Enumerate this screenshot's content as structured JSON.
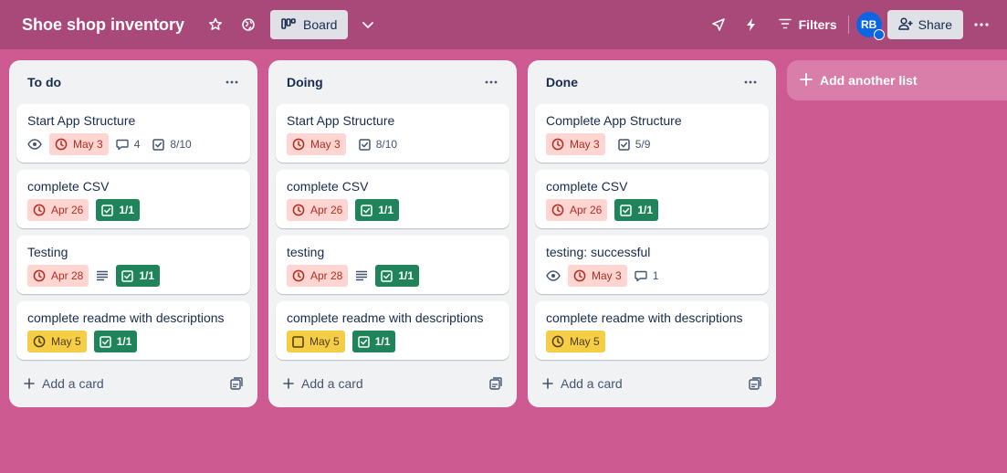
{
  "header": {
    "title": "Shoe shop inventory",
    "view_label": "Board",
    "filters_label": "Filters",
    "avatar_initials": "RB",
    "share_label": "Share"
  },
  "lists": [
    {
      "title": "To do",
      "cards": [
        {
          "title": "Start App Structure",
          "watch": true,
          "due": "May 3",
          "due_style": "red",
          "comments": "4",
          "checklist": "8/10",
          "check_done": false
        },
        {
          "title": "complete CSV",
          "due": "Apr 26",
          "due_style": "red",
          "checklist": "1/1",
          "check_done": true
        },
        {
          "title": "Testing",
          "due": "Apr 28",
          "due_style": "red",
          "description": true,
          "checklist": "1/1",
          "check_done": true
        },
        {
          "title": "complete readme with descriptions",
          "due": "May 5",
          "due_style": "yellow",
          "checklist": "1/1",
          "check_done": true
        }
      ],
      "add_card_label": "Add a card"
    },
    {
      "title": "Doing",
      "cards": [
        {
          "title": "Start App Structure",
          "due": "May 3",
          "due_style": "red",
          "checklist": "8/10",
          "check_done": false
        },
        {
          "title": "complete CSV",
          "due": "Apr 26",
          "due_style": "red",
          "checklist": "1/1",
          "check_done": true
        },
        {
          "title": "testing",
          "due": "Apr 28",
          "due_style": "red",
          "description": true,
          "checklist": "1/1",
          "check_done": true
        },
        {
          "title": "complete readme with descriptions",
          "due": "May 5",
          "due_style": "yellow",
          "due_checkbox": true,
          "checklist": "1/1",
          "check_done": true
        }
      ],
      "add_card_label": "Add a card"
    },
    {
      "title": "Done",
      "cards": [
        {
          "title": "Complete App Structure",
          "due": "May 3",
          "due_style": "red",
          "checklist": "5/9",
          "check_done": false
        },
        {
          "title": "complete CSV",
          "due": "Apr 26",
          "due_style": "red",
          "checklist": "1/1",
          "check_done": true
        },
        {
          "title": "testing: successful",
          "watch": true,
          "due": "May 3",
          "due_style": "red",
          "comments": "1"
        },
        {
          "title": "complete readme with descriptions",
          "due": "May 5",
          "due_style": "yellow"
        }
      ],
      "add_card_label": "Add a card"
    }
  ],
  "add_list_label": "Add another list",
  "colors": {
    "board_background": "#cd5a91",
    "header_background": "#a8497a",
    "due_red_bg": "#ffd5d2",
    "due_yellow_bg": "#f5cd47",
    "checklist_done_bg": "#1f845a"
  }
}
